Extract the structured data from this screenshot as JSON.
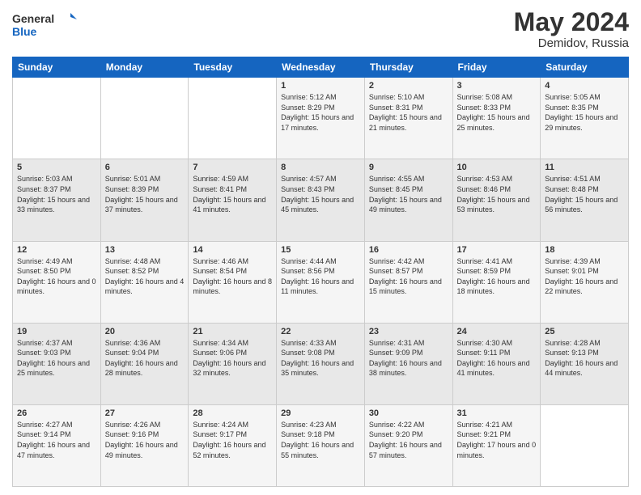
{
  "header": {
    "logo_line1": "General",
    "logo_line2": "Blue",
    "month_year": "May 2024",
    "location": "Demidov, Russia"
  },
  "days_of_week": [
    "Sunday",
    "Monday",
    "Tuesday",
    "Wednesday",
    "Thursday",
    "Friday",
    "Saturday"
  ],
  "weeks": [
    [
      {
        "day": "",
        "sunrise": "",
        "sunset": "",
        "daylight": ""
      },
      {
        "day": "",
        "sunrise": "",
        "sunset": "",
        "daylight": ""
      },
      {
        "day": "",
        "sunrise": "",
        "sunset": "",
        "daylight": ""
      },
      {
        "day": "1",
        "sunrise": "Sunrise: 5:12 AM",
        "sunset": "Sunset: 8:29 PM",
        "daylight": "Daylight: 15 hours and 17 minutes."
      },
      {
        "day": "2",
        "sunrise": "Sunrise: 5:10 AM",
        "sunset": "Sunset: 8:31 PM",
        "daylight": "Daylight: 15 hours and 21 minutes."
      },
      {
        "day": "3",
        "sunrise": "Sunrise: 5:08 AM",
        "sunset": "Sunset: 8:33 PM",
        "daylight": "Daylight: 15 hours and 25 minutes."
      },
      {
        "day": "4",
        "sunrise": "Sunrise: 5:05 AM",
        "sunset": "Sunset: 8:35 PM",
        "daylight": "Daylight: 15 hours and 29 minutes."
      }
    ],
    [
      {
        "day": "5",
        "sunrise": "Sunrise: 5:03 AM",
        "sunset": "Sunset: 8:37 PM",
        "daylight": "Daylight: 15 hours and 33 minutes."
      },
      {
        "day": "6",
        "sunrise": "Sunrise: 5:01 AM",
        "sunset": "Sunset: 8:39 PM",
        "daylight": "Daylight: 15 hours and 37 minutes."
      },
      {
        "day": "7",
        "sunrise": "Sunrise: 4:59 AM",
        "sunset": "Sunset: 8:41 PM",
        "daylight": "Daylight: 15 hours and 41 minutes."
      },
      {
        "day": "8",
        "sunrise": "Sunrise: 4:57 AM",
        "sunset": "Sunset: 8:43 PM",
        "daylight": "Daylight: 15 hours and 45 minutes."
      },
      {
        "day": "9",
        "sunrise": "Sunrise: 4:55 AM",
        "sunset": "Sunset: 8:45 PM",
        "daylight": "Daylight: 15 hours and 49 minutes."
      },
      {
        "day": "10",
        "sunrise": "Sunrise: 4:53 AM",
        "sunset": "Sunset: 8:46 PM",
        "daylight": "Daylight: 15 hours and 53 minutes."
      },
      {
        "day": "11",
        "sunrise": "Sunrise: 4:51 AM",
        "sunset": "Sunset: 8:48 PM",
        "daylight": "Daylight: 15 hours and 56 minutes."
      }
    ],
    [
      {
        "day": "12",
        "sunrise": "Sunrise: 4:49 AM",
        "sunset": "Sunset: 8:50 PM",
        "daylight": "Daylight: 16 hours and 0 minutes."
      },
      {
        "day": "13",
        "sunrise": "Sunrise: 4:48 AM",
        "sunset": "Sunset: 8:52 PM",
        "daylight": "Daylight: 16 hours and 4 minutes."
      },
      {
        "day": "14",
        "sunrise": "Sunrise: 4:46 AM",
        "sunset": "Sunset: 8:54 PM",
        "daylight": "Daylight: 16 hours and 8 minutes."
      },
      {
        "day": "15",
        "sunrise": "Sunrise: 4:44 AM",
        "sunset": "Sunset: 8:56 PM",
        "daylight": "Daylight: 16 hours and 11 minutes."
      },
      {
        "day": "16",
        "sunrise": "Sunrise: 4:42 AM",
        "sunset": "Sunset: 8:57 PM",
        "daylight": "Daylight: 16 hours and 15 minutes."
      },
      {
        "day": "17",
        "sunrise": "Sunrise: 4:41 AM",
        "sunset": "Sunset: 8:59 PM",
        "daylight": "Daylight: 16 hours and 18 minutes."
      },
      {
        "day": "18",
        "sunrise": "Sunrise: 4:39 AM",
        "sunset": "Sunset: 9:01 PM",
        "daylight": "Daylight: 16 hours and 22 minutes."
      }
    ],
    [
      {
        "day": "19",
        "sunrise": "Sunrise: 4:37 AM",
        "sunset": "Sunset: 9:03 PM",
        "daylight": "Daylight: 16 hours and 25 minutes."
      },
      {
        "day": "20",
        "sunrise": "Sunrise: 4:36 AM",
        "sunset": "Sunset: 9:04 PM",
        "daylight": "Daylight: 16 hours and 28 minutes."
      },
      {
        "day": "21",
        "sunrise": "Sunrise: 4:34 AM",
        "sunset": "Sunset: 9:06 PM",
        "daylight": "Daylight: 16 hours and 32 minutes."
      },
      {
        "day": "22",
        "sunrise": "Sunrise: 4:33 AM",
        "sunset": "Sunset: 9:08 PM",
        "daylight": "Daylight: 16 hours and 35 minutes."
      },
      {
        "day": "23",
        "sunrise": "Sunrise: 4:31 AM",
        "sunset": "Sunset: 9:09 PM",
        "daylight": "Daylight: 16 hours and 38 minutes."
      },
      {
        "day": "24",
        "sunrise": "Sunrise: 4:30 AM",
        "sunset": "Sunset: 9:11 PM",
        "daylight": "Daylight: 16 hours and 41 minutes."
      },
      {
        "day": "25",
        "sunrise": "Sunrise: 4:28 AM",
        "sunset": "Sunset: 9:13 PM",
        "daylight": "Daylight: 16 hours and 44 minutes."
      }
    ],
    [
      {
        "day": "26",
        "sunrise": "Sunrise: 4:27 AM",
        "sunset": "Sunset: 9:14 PM",
        "daylight": "Daylight: 16 hours and 47 minutes."
      },
      {
        "day": "27",
        "sunrise": "Sunrise: 4:26 AM",
        "sunset": "Sunset: 9:16 PM",
        "daylight": "Daylight: 16 hours and 49 minutes."
      },
      {
        "day": "28",
        "sunrise": "Sunrise: 4:24 AM",
        "sunset": "Sunset: 9:17 PM",
        "daylight": "Daylight: 16 hours and 52 minutes."
      },
      {
        "day": "29",
        "sunrise": "Sunrise: 4:23 AM",
        "sunset": "Sunset: 9:18 PM",
        "daylight": "Daylight: 16 hours and 55 minutes."
      },
      {
        "day": "30",
        "sunrise": "Sunrise: 4:22 AM",
        "sunset": "Sunset: 9:20 PM",
        "daylight": "Daylight: 16 hours and 57 minutes."
      },
      {
        "day": "31",
        "sunrise": "Sunrise: 4:21 AM",
        "sunset": "Sunset: 9:21 PM",
        "daylight": "Daylight: 17 hours and 0 minutes."
      },
      {
        "day": "",
        "sunrise": "",
        "sunset": "",
        "daylight": ""
      }
    ]
  ]
}
